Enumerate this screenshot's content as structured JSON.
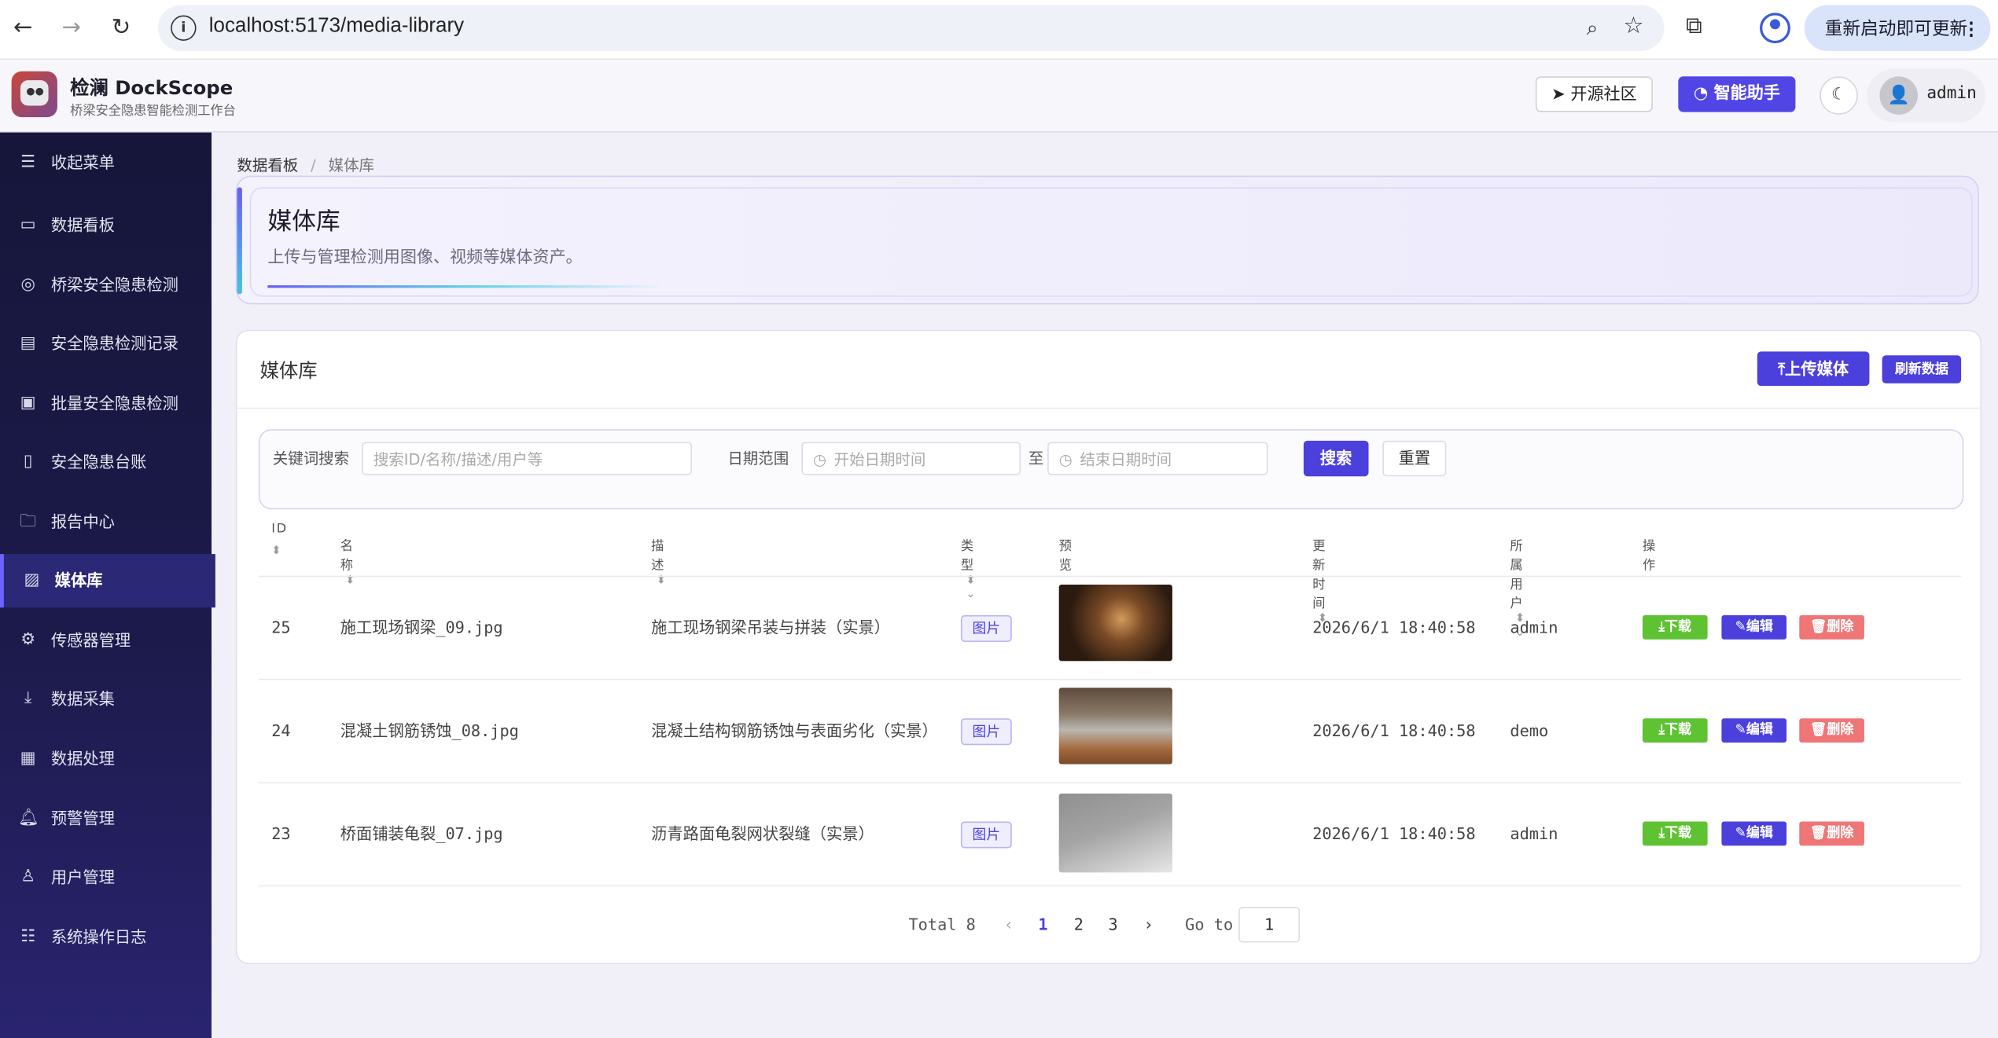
{
  "browser": {
    "url": "localhost:5173/media-library",
    "update_label": "重新启动即可更新"
  },
  "header": {
    "brand_title": "检澜 DockScope",
    "brand_subtitle": "桥梁安全隐患智能检测工作台",
    "community_label": "开源社区",
    "assistant_label": "智能助手",
    "username": "admin"
  },
  "sidebar": {
    "items": [
      {
        "label": "收起菜单",
        "icon": "menu-icon"
      },
      {
        "label": "数据看板",
        "icon": "dashboard-icon"
      },
      {
        "label": "桥梁安全隐患检测",
        "icon": "target-icon"
      },
      {
        "label": "安全隐患检测记录",
        "icon": "clipboard-icon"
      },
      {
        "label": "批量安全隐患检测",
        "icon": "batch-icon"
      },
      {
        "label": "安全隐患台账",
        "icon": "ledger-icon"
      },
      {
        "label": "报告中心",
        "icon": "folder-icon"
      },
      {
        "label": "媒体库",
        "icon": "image-icon"
      },
      {
        "label": "传感器管理",
        "icon": "sensor-icon"
      },
      {
        "label": "数据采集",
        "icon": "download-icon"
      },
      {
        "label": "数据处理",
        "icon": "processing-icon"
      },
      {
        "label": "预警管理",
        "icon": "bell-icon"
      },
      {
        "label": "用户管理",
        "icon": "user-icon"
      },
      {
        "label": "系统操作日志",
        "icon": "sliders-icon"
      }
    ],
    "active_index": 7
  },
  "breadcrumb": {
    "root": "数据看板",
    "separator": "/",
    "current": "媒体库"
  },
  "hero": {
    "title": "媒体库",
    "subtitle": "上传与管理检测用图像、视频等媒体资产。"
  },
  "card": {
    "title": "媒体库",
    "upload_label": "上传媒体",
    "refresh_label": "刷新数据"
  },
  "filter": {
    "keyword_label": "关键词搜索",
    "keyword_placeholder": "搜索ID/名称/描述/用户等",
    "date_label": "日期范围",
    "start_placeholder": "开始日期时间",
    "to_label": "至",
    "end_placeholder": "结束日期时间",
    "search_label": "搜索",
    "reset_label": "重置"
  },
  "table": {
    "columns": [
      "ID",
      "名称",
      "描述",
      "类型",
      "预览",
      "更新时间",
      "所属用户",
      "操作"
    ],
    "rows": [
      {
        "id": "25",
        "name": "施工现场钢梁_09.jpg",
        "desc": "施工现场钢梁吊装与拼装（实景）",
        "type": "图片",
        "updated": "2026/6/1 18:40:58",
        "user": "admin"
      },
      {
        "id": "24",
        "name": "混凝土钢筋锈蚀_08.jpg",
        "desc": "混凝土结构钢筋锈蚀与表面劣化（实景）",
        "type": "图片",
        "updated": "2026/6/1 18:40:58",
        "user": "demo"
      },
      {
        "id": "23",
        "name": "桥面铺装龟裂_07.jpg",
        "desc": "沥青路面龟裂网状裂缝（实景）",
        "type": "图片",
        "updated": "2026/6/1 18:40:58",
        "user": "admin"
      }
    ],
    "actions": {
      "download": "下载",
      "edit": "编辑",
      "delete": "删除"
    }
  },
  "pagination": {
    "total_label": "Total 8",
    "pages": [
      "1",
      "2",
      "3"
    ],
    "current_page": "1",
    "goto_label": "Go to",
    "goto_value": "1"
  }
}
